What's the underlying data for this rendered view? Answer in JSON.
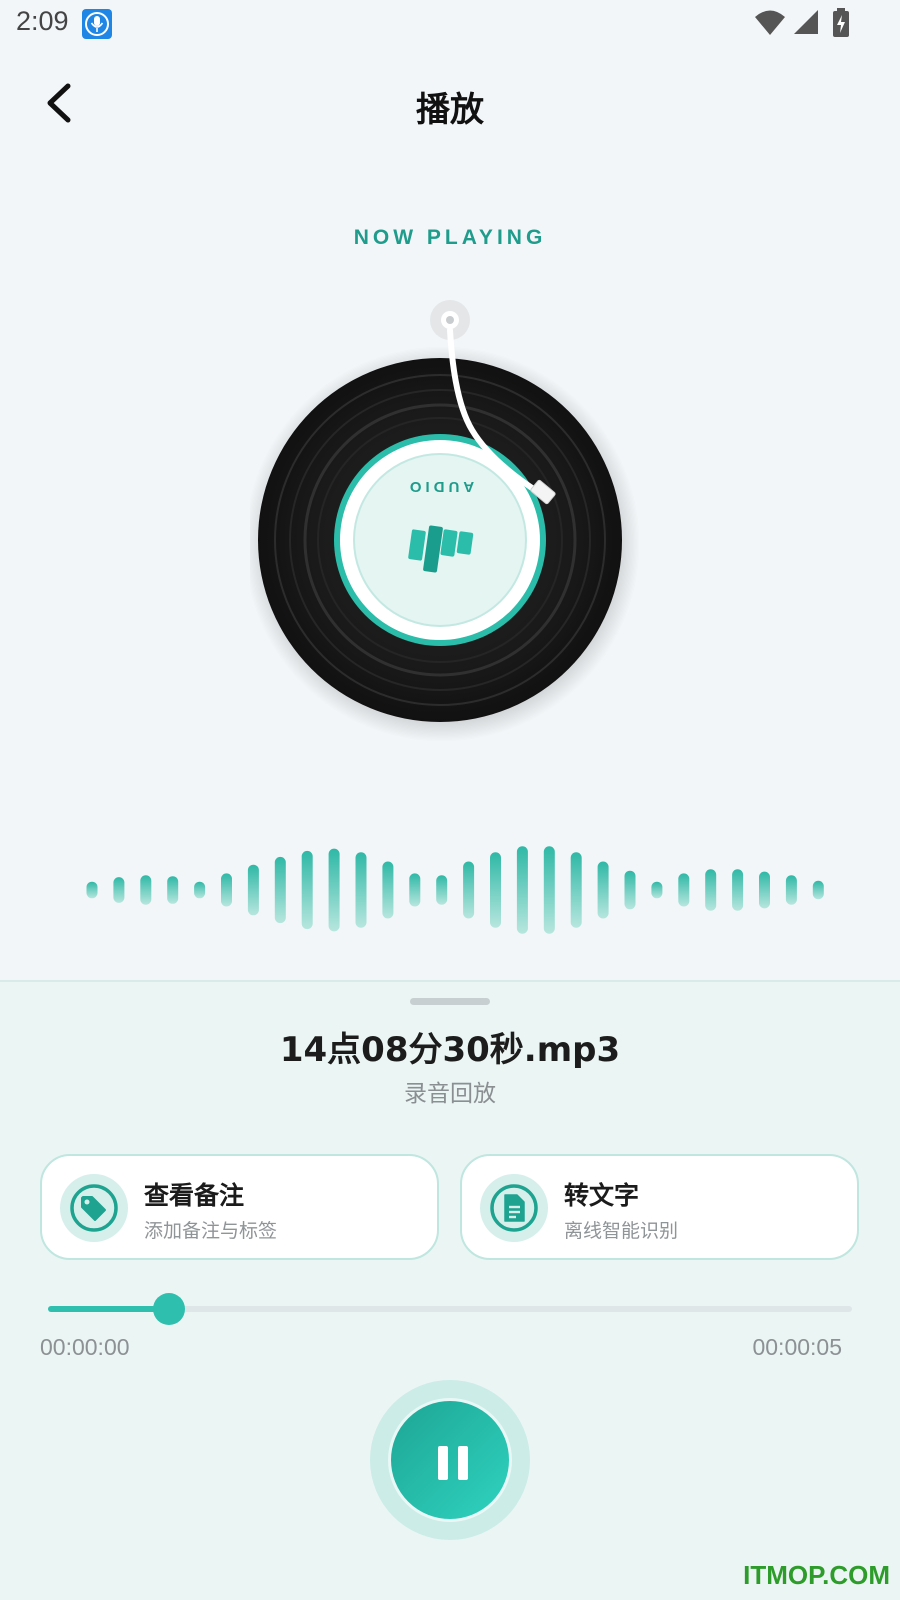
{
  "status": {
    "time": "2:09",
    "app_icon": "microphone-icon",
    "icons": [
      "wifi-icon",
      "signal-icon",
      "battery-charging-icon"
    ]
  },
  "header": {
    "back_icon": "chevron-left-icon",
    "title": "播放"
  },
  "now_playing": "NOW PLAYING",
  "record": {
    "label_text": "AUDIO",
    "logo": "audio-logo-icon"
  },
  "waveform_levels": [
    0.18,
    0.28,
    0.32,
    0.3,
    0.18,
    0.36,
    0.55,
    0.72,
    0.85,
    0.9,
    0.82,
    0.62,
    0.36,
    0.32,
    0.62,
    0.82,
    0.95,
    0.95,
    0.82,
    0.62,
    0.42,
    0.18,
    0.36,
    0.45,
    0.45,
    0.4,
    0.32,
    0.2
  ],
  "track": {
    "file_name": "14点08分30秒.mp3",
    "subtitle": "录音回放"
  },
  "actions": [
    {
      "title": "查看备注",
      "desc": "添加备注与标签",
      "icon": "tag-icon"
    },
    {
      "title": "转文字",
      "desc": "离线智能识别",
      "icon": "document-icon"
    }
  ],
  "playback": {
    "progress": 0.15,
    "current_time": "00:00:00",
    "total_time": "00:00:05",
    "state_icon": "pause-icon"
  },
  "colors": {
    "accent": "#2fbfae",
    "accent_dark": "#1f9c8c",
    "panel_bg": "#ebf5f4"
  },
  "watermark": "ITMOP.COM"
}
